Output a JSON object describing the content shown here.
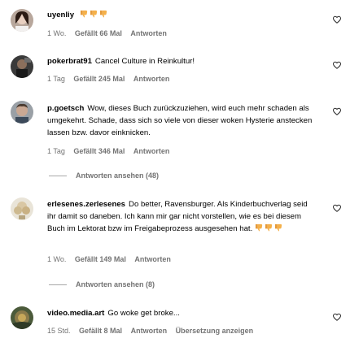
{
  "comments": [
    {
      "user": "uyenliy",
      "text": "",
      "emoji_count": 3,
      "time": "1 Wo.",
      "likes": "Gefällt 66 Mal",
      "reply": "Antworten"
    },
    {
      "user": "pokerbrat91",
      "text": "Cancel Culture in Reinkultur!",
      "time": "1 Tag",
      "likes": "Gefällt 245 Mal",
      "reply": "Antworten"
    },
    {
      "user": "p.goetsch",
      "text": "Wow, dieses Buch zurückzuziehen, wird euch mehr schaden als umgekehrt. Schade, dass sich so viele von dieser woken Hysterie anstecken lassen bzw. davor einknicken.",
      "time": "1 Tag",
      "likes": "Gefällt 346 Mal",
      "reply": "Antworten",
      "view_replies": "Antworten ansehen (48)"
    },
    {
      "user": "erlesenes.zerlesenes",
      "text": "Do better, Ravensburger. Als Kinderbuchverlag seid ihr damit so daneben. Ich kann mir gar nicht vorstellen, wie es bei diesem Buch im Lektorat bzw im Freigabeprozess ausgesehen hat.",
      "emoji_count": 3,
      "time": "1 Wo.",
      "likes": "Gefällt 149 Mal",
      "reply": "Antworten",
      "view_replies": "Antworten ansehen (8)"
    },
    {
      "user": "video.media.art",
      "text": "Go woke get broke...",
      "time": "15 Std.",
      "likes": "Gefällt 8 Mal",
      "reply": "Antworten",
      "translate": "Übersetzung anzeigen"
    }
  ],
  "icons": {
    "like": "heart-outline-icon",
    "reaction": "thumbs-down-emoji"
  },
  "colors": {
    "text": "#000000",
    "meta": "#737373",
    "emoji": "#f0a640"
  }
}
